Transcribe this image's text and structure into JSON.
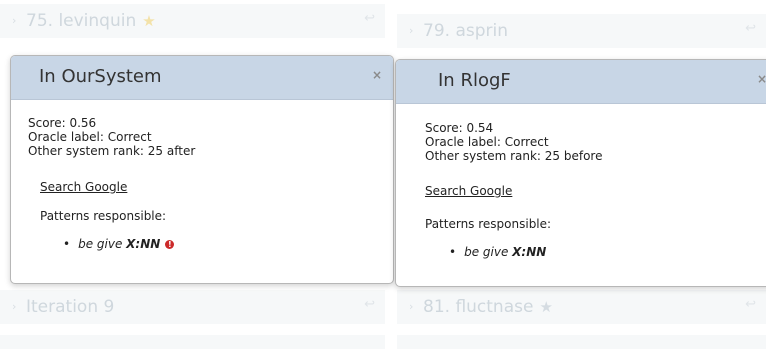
{
  "background_list": [
    {
      "label": "75. levinquin",
      "badge_icon": "star-icon",
      "badge_color": "#f3e2a9"
    },
    {
      "label": "79. asprin"
    },
    {
      "label": "Iteration 9"
    },
    {
      "label": "81. fluctnase",
      "badge_icon": "star-icon",
      "badge_color": "#d5dce2"
    }
  ],
  "popovers": [
    {
      "title": "In OurSystem",
      "close": "×",
      "score": "Score: 0.56",
      "oracle": "Oracle label: Correct",
      "rank": "Other system rank: 25 after",
      "search": "Search Google",
      "patterns_label": "Patterns responsible:",
      "pattern_prefix": "be give",
      "pattern_bold": "X:NN",
      "warning": "!"
    },
    {
      "title": "In RlogF",
      "close": "×",
      "score": "Score: 0.54",
      "oracle": "Oracle label: Correct",
      "rank": "Other system rank: 25 before",
      "search": "Search Google",
      "patterns_label": "Patterns responsible:",
      "pattern_prefix": "be give",
      "pattern_bold": "X:NN"
    }
  ],
  "colors": {
    "header": "#c8d6e6",
    "warning": "#cc2a2a"
  }
}
